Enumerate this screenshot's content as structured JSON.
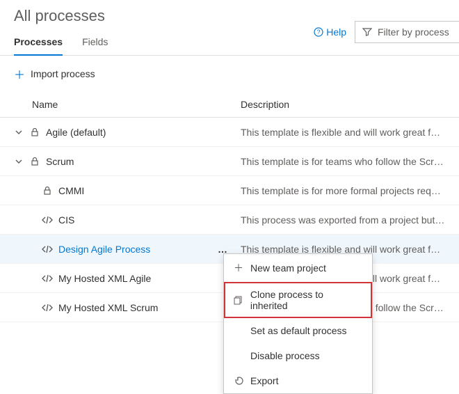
{
  "header": {
    "title": "All processes",
    "help_label": "Help",
    "filter_placeholder": "Filter by process name"
  },
  "tabs": {
    "processes": "Processes",
    "fields": "Fields"
  },
  "toolbar": {
    "import_label": "Import process"
  },
  "columns": {
    "name": "Name",
    "description": "Description"
  },
  "rows": [
    {
      "name": "Agile (default)",
      "description": "This template is flexible and will work great for …",
      "expandable": true,
      "type": "lock",
      "indent": 0,
      "link": false,
      "selected": false,
      "menu": false
    },
    {
      "name": "Scrum",
      "description": "This template is for teams who follow the Scru…",
      "expandable": true,
      "type": "lock",
      "indent": 0,
      "link": false,
      "selected": false,
      "menu": false
    },
    {
      "name": "CMMI",
      "description": "This template is for more formal projects requi…",
      "expandable": false,
      "type": "lock",
      "indent": 1,
      "link": false,
      "selected": false,
      "menu": false
    },
    {
      "name": "CIS",
      "description": "This process was exported from a project but n…",
      "expandable": false,
      "type": "code",
      "indent": 1,
      "link": false,
      "selected": false,
      "menu": false
    },
    {
      "name": "Design Agile Process",
      "description": "This template is flexible and will work great for …",
      "expandable": false,
      "type": "code",
      "indent": 1,
      "link": true,
      "selected": true,
      "menu": true
    },
    {
      "name": "My Hosted XML Agile",
      "description": "This template is flexible and will work great for …",
      "expandable": false,
      "type": "code",
      "indent": 1,
      "link": false,
      "selected": false,
      "menu": false
    },
    {
      "name": "My Hosted XML Scrum",
      "description": "This template is for teams who follow the Scru…",
      "expandable": false,
      "type": "code",
      "indent": 1,
      "link": false,
      "selected": false,
      "menu": false
    }
  ],
  "context_menu": {
    "new_team_project": "New team project",
    "clone": "Clone process to inherited",
    "set_default": "Set as default process",
    "disable": "Disable process",
    "export": "Export"
  }
}
